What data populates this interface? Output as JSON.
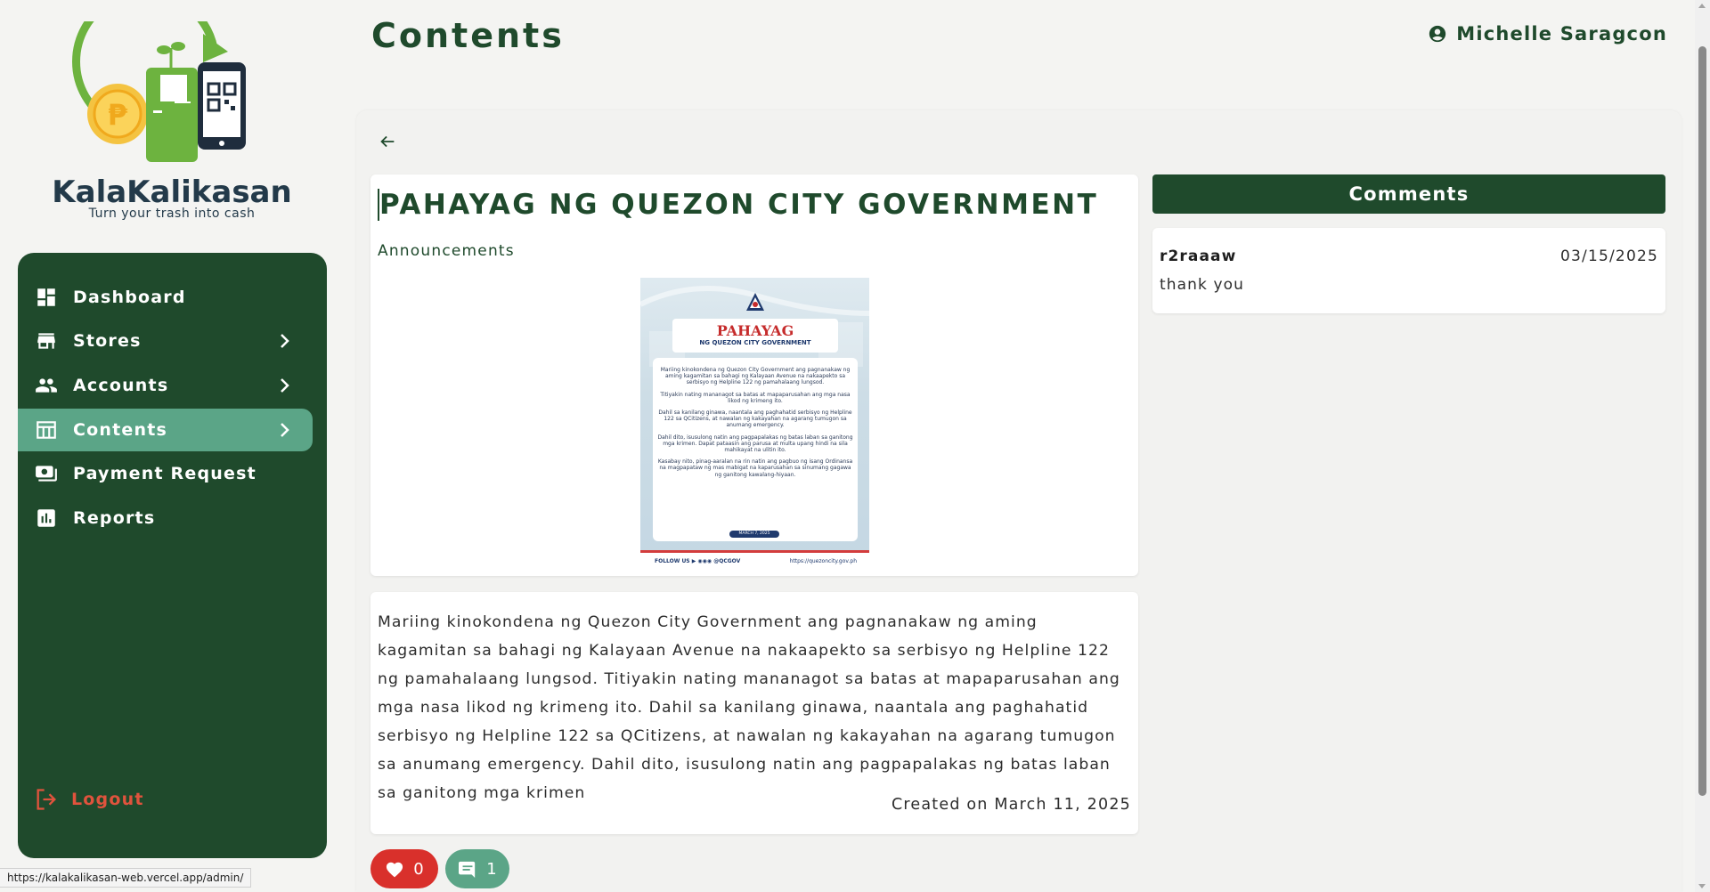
{
  "brand": {
    "name": "KalaKalikasan",
    "tagline": "Turn your trash into cash"
  },
  "sidebar": {
    "items": [
      {
        "label": "Dashboard",
        "icon": "dashboard-icon"
      },
      {
        "label": "Stores",
        "icon": "store-icon",
        "has_submenu": true
      },
      {
        "label": "Accounts",
        "icon": "accounts-icon",
        "has_submenu": true
      },
      {
        "label": "Contents",
        "icon": "contents-icon",
        "has_submenu": true,
        "active": true
      },
      {
        "label": "Payment Request",
        "icon": "payment-icon"
      },
      {
        "label": "Reports",
        "icon": "reports-icon"
      }
    ],
    "logout_label": "Logout"
  },
  "header": {
    "title": "Contents",
    "user_name": "Michelle Saragcon"
  },
  "post": {
    "title": "PAHAYAG NG QUEZON CITY GOVERNMENT",
    "category": "Announcements",
    "image": {
      "heading": "PAHAYAG",
      "subheading": "NG QUEZON CITY GOVERNMENT",
      "paragraphs": [
        "Mariing kinokondena ng Quezon City Government ang pagnanakaw ng aming kagamitan sa bahagi ng Kalayaan Avenue na nakaapekto sa serbisyo ng Helpline 122 ng pamahalaang lungsod.",
        "Titiyakin nating mananagot sa batas at mapaparusahan ang mga nasa likod ng krimeng ito.",
        "Dahil sa kanilang ginawa, naantala ang paghahatid serbisyo ng Helpline 122 sa QCitizens, at nawalan ng kakayahan na agarang tumugon sa anumang emergency.",
        "Dahil dito, isusulong natin ang pagpapalakas ng batas laban sa ganitong mga krimen. Dapat pataasin ang parusa at multa upang hindi na sila mahikayat na ulitin ito.",
        "Kasabay nito, pinag-aaralan na rin natin ang pagbuo ng isang Ordinansa na magpapataw ng mas mabigat na kaparusahan sa sinumang gagawa ng ganitong kawalang-hiyaan."
      ],
      "date_badge": "MARCH 7, 2025",
      "follow_text": "FOLLOW US ▶ ◉◉◉ @QCGOV",
      "url_text": "https://quezoncity.gov.ph"
    },
    "body": "Mariing kinokondena ng Quezon City Government ang pagnanakaw ng aming kagamitan sa bahagi ng Kalayaan Avenue na nakaapekto sa serbisyo ng Helpline 122 ng pamahalaang lungsod. Titiyakin nating mananagot sa batas at mapaparusahan ang mga nasa likod ng krimeng ito. Dahil sa kanilang ginawa, naantala ang paghahatid serbisyo ng Helpline 122 sa QCitizens, at nawalan ng kakayahan na agarang tumugon sa anumang emergency. Dahil dito, isusulong natin ang pagpapalakas ng batas laban sa ganitong mga krimen",
    "created": "Created on March 11, 2025",
    "likes": "0",
    "comments_count": "1"
  },
  "comments": {
    "header": "Comments",
    "items": [
      {
        "user": "r2raaaw",
        "date": "03/15/2025",
        "text": "thank you"
      }
    ]
  },
  "status_bar": {
    "url": "https://kalakalikasan-web.vercel.app/admin/"
  },
  "colors": {
    "primary_green": "#1f4a2c",
    "accent_green": "#5ba587",
    "like_red": "#d9302b",
    "logout_red": "#e0533d"
  }
}
